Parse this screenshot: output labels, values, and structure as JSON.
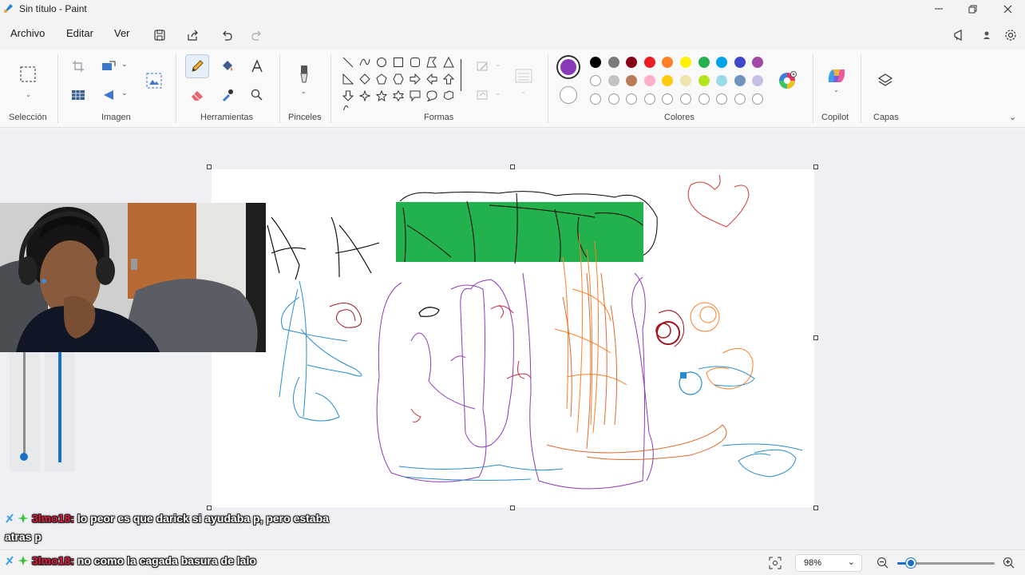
{
  "window": {
    "title": "Sin título - Paint"
  },
  "menu": {
    "items": [
      "Archivo",
      "Editar",
      "Ver"
    ]
  },
  "ribbon": {
    "groups": {
      "seleccion": "Selección",
      "imagen": "Imagen",
      "herramientas": "Herramientas",
      "pinceles": "Pinceles",
      "formas": "Formas",
      "colores": "Colores",
      "copilot": "Copilot",
      "capas": "Capas"
    },
    "active_tool": "pencil-icon",
    "primary_color": "#8a3ab9",
    "secondary_color": "#ffffff",
    "palette_row1": [
      "#000000",
      "#7a7a7a",
      "#880015",
      "#ed1c24",
      "#ff7f27",
      "#fff200",
      "#22b14c",
      "#00a2e8",
      "#3f48cc",
      "#a349a4"
    ],
    "palette_row2": [
      "#ffffff",
      "#c3c3c3",
      "#b97a57",
      "#ffaec9",
      "#ffc90e",
      "#efe4b0",
      "#b5e61d",
      "#99d9ea",
      "#7092be",
      "#c8bfe7"
    ]
  },
  "chat": {
    "messages": [
      {
        "user": "3lmo18:",
        "text": "lo peor es que darick si ayudaba p, pero estaba",
        "text_cont": "atras p"
      },
      {
        "user": "3lmo18:",
        "text": "no como la cagada basura de lalo"
      }
    ]
  },
  "status": {
    "zoom": "98%",
    "zoom_level": 0.14
  }
}
